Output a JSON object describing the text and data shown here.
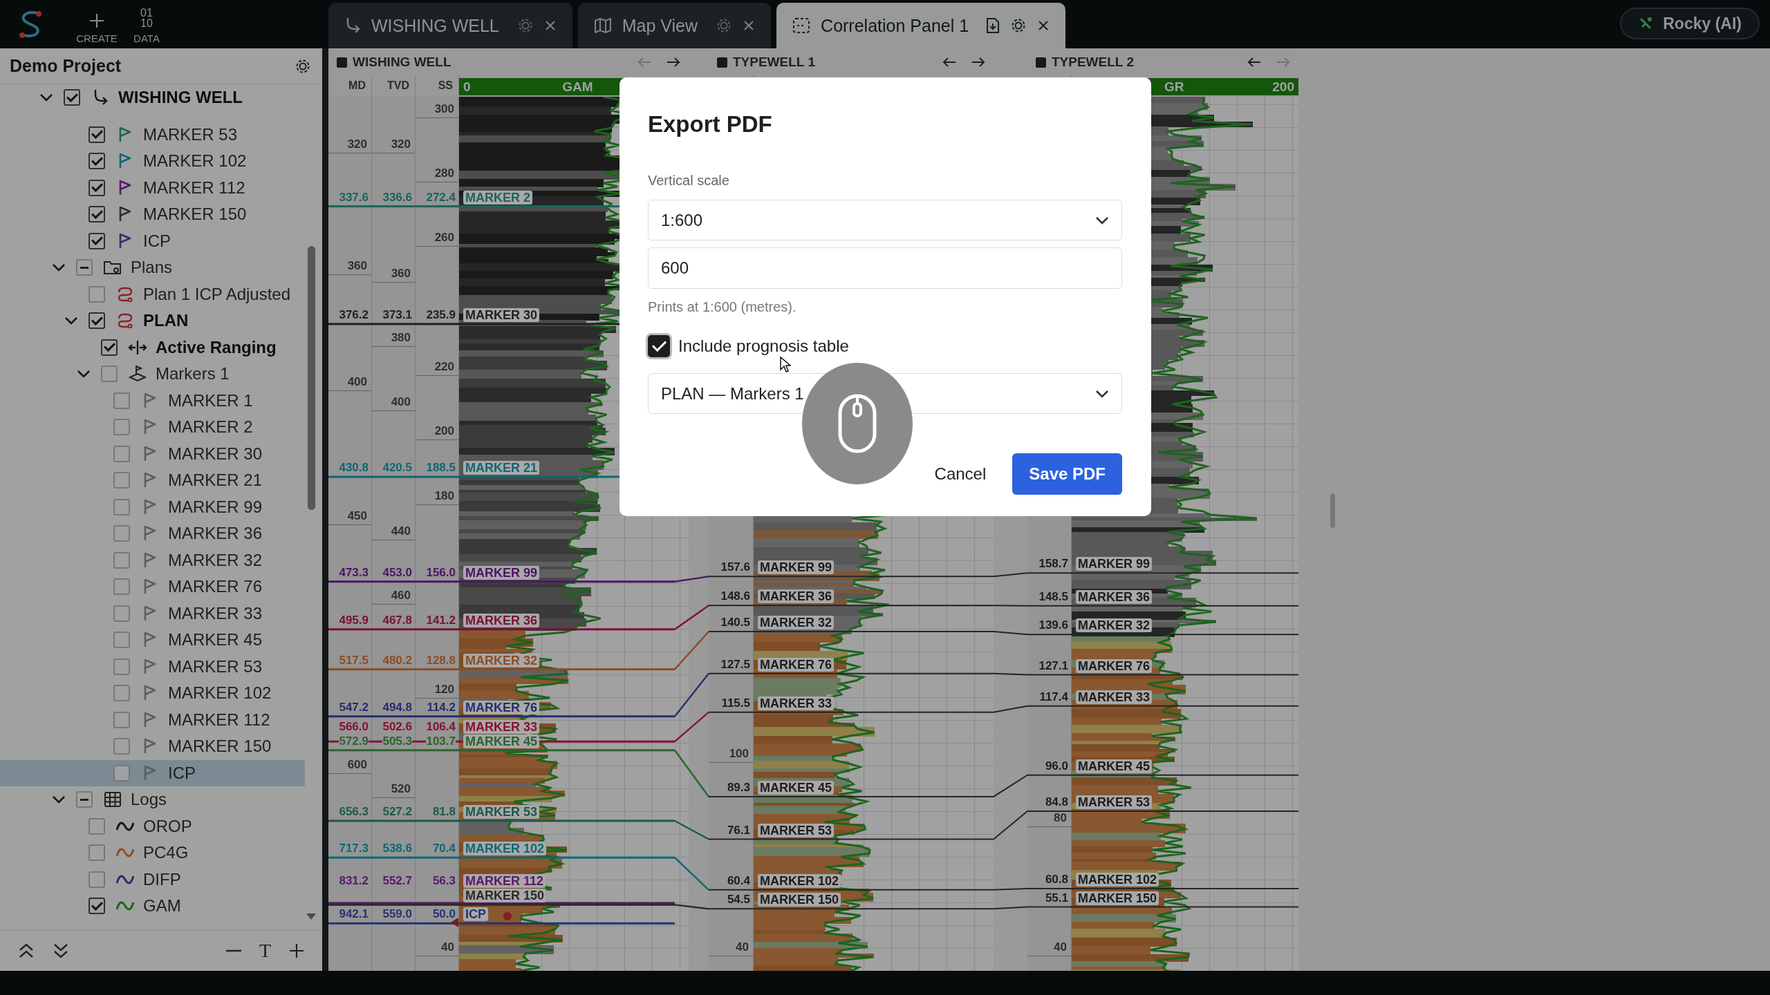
{
  "app_bar": {
    "actions": [
      {
        "kind": "create",
        "label": "CREATE"
      },
      {
        "kind": "data",
        "label": "DATA",
        "glyph": [
          "01",
          "10"
        ]
      }
    ]
  },
  "tabs": [
    {
      "kind": "well",
      "label": "WISHING WELL",
      "selected": false
    },
    {
      "kind": "map",
      "label": "Map View",
      "selected": false
    },
    {
      "kind": "correlation",
      "label": "Correlation Panel 1",
      "selected": true
    }
  ],
  "assistant": {
    "label": "Rocky (AI)"
  },
  "sidebar": {
    "title": "Demo Project",
    "toolbar": {
      "glyph": "T"
    },
    "tree": [
      {
        "kind": "well",
        "label": "WISHING WELL",
        "bold": true,
        "checked": true,
        "expanded": true,
        "selected": false,
        "children": [
          {
            "kind": "marker",
            "label": "MARKER 53",
            "bold": false,
            "checked": true,
            "selected": false,
            "color": "#1d644f"
          },
          {
            "kind": "marker",
            "label": "MARKER 102",
            "bold": false,
            "checked": true,
            "selected": false,
            "color": "#0d6774"
          },
          {
            "kind": "marker",
            "label": "MARKER 112",
            "bold": false,
            "checked": true,
            "selected": false,
            "color": "#59176b"
          },
          {
            "kind": "marker",
            "label": "MARKER 150",
            "bold": false,
            "checked": true,
            "selected": false,
            "color": "#2f2f2f"
          },
          {
            "kind": "marker",
            "label": "ICP",
            "bold": false,
            "checked": true,
            "selected": false,
            "color": "#283372"
          },
          {
            "kind": "folder",
            "label": "Plans",
            "bold": false,
            "checked": false,
            "partial": true,
            "expanded": true,
            "selected": false,
            "children": [
              {
                "kind": "plan",
                "label": "Plan 1 ICP Adjusted",
                "bold": false,
                "checked": false,
                "partial": false,
                "selected": false
              },
              {
                "kind": "plan",
                "label": "PLAN",
                "bold": true,
                "checked": true,
                "expanded": true,
                "selected": false,
                "children": [
                  {
                    "kind": "ranging",
                    "label": "Active Ranging",
                    "bold": true,
                    "checked": true,
                    "selected": false
                  },
                  {
                    "kind": "marker_set",
                    "label": "Markers 1",
                    "bold": false,
                    "checked": false,
                    "partial": false,
                    "expanded": true,
                    "selected": false,
                    "children": [
                      {
                        "kind": "marker",
                        "label": "MARKER 1",
                        "bold": false,
                        "checked": false,
                        "partial": false,
                        "selected": false
                      },
                      {
                        "kind": "marker",
                        "label": "MARKER 2",
                        "bold": false,
                        "checked": false,
                        "partial": false,
                        "selected": false
                      },
                      {
                        "kind": "marker",
                        "label": "MARKER 30",
                        "bold": false,
                        "checked": false,
                        "partial": false,
                        "selected": false
                      },
                      {
                        "kind": "marker",
                        "label": "MARKER 21",
                        "bold": false,
                        "checked": false,
                        "partial": false,
                        "selected": false
                      },
                      {
                        "kind": "marker",
                        "label": "MARKER 99",
                        "bold": false,
                        "checked": false,
                        "partial": false,
                        "selected": false
                      },
                      {
                        "kind": "marker",
                        "label": "MARKER 36",
                        "bold": false,
                        "checked": false,
                        "partial": false,
                        "selected": false
                      },
                      {
                        "kind": "marker",
                        "label": "MARKER 32",
                        "bold": false,
                        "checked": false,
                        "partial": false,
                        "selected": false
                      },
                      {
                        "kind": "marker",
                        "label": "MARKER 76",
                        "bold": false,
                        "checked": false,
                        "partial": false,
                        "selected": false
                      },
                      {
                        "kind": "marker",
                        "label": "MARKER 33",
                        "bold": false,
                        "checked": false,
                        "partial": false,
                        "selected": false
                      },
                      {
                        "kind": "marker",
                        "label": "MARKER 45",
                        "bold": false,
                        "checked": false,
                        "partial": false,
                        "selected": false
                      },
                      {
                        "kind": "marker",
                        "label": "MARKER 53",
                        "bold": false,
                        "checked": false,
                        "partial": false,
                        "selected": false
                      },
                      {
                        "kind": "marker",
                        "label": "MARKER 102",
                        "bold": false,
                        "checked": false,
                        "partial": false,
                        "selected": false
                      },
                      {
                        "kind": "marker",
                        "label": "MARKER 112",
                        "bold": false,
                        "checked": false,
                        "partial": false,
                        "selected": false
                      },
                      {
                        "kind": "marker",
                        "label": "MARKER 150",
                        "bold": false,
                        "checked": false,
                        "partial": false,
                        "selected": false
                      },
                      {
                        "kind": "marker",
                        "label": "ICP",
                        "bold": false,
                        "checked": false,
                        "partial": false,
                        "selected": true
                      }
                    ]
                  }
                ]
              }
            ]
          },
          {
            "kind": "logs",
            "label": "Logs",
            "bold": false,
            "checked": false,
            "partial": true,
            "expanded": true,
            "selected": false,
            "children": [
              {
                "kind": "log",
                "label": "OROP",
                "bold": false,
                "checked": false,
                "partial": false,
                "selected": false,
                "color": "#151515"
              },
              {
                "kind": "log",
                "label": "PC4G",
                "bold": false,
                "checked": false,
                "partial": false,
                "selected": false,
                "color": "#8d4d24"
              },
              {
                "kind": "log",
                "label": "DIFP",
                "bold": false,
                "checked": false,
                "partial": false,
                "selected": false,
                "color": "#242e6c"
              },
              {
                "kind": "log",
                "label": "GAM",
                "bold": false,
                "checked": true,
                "selected": false,
                "color": "#1d641d"
              }
            ]
          }
        ]
      }
    ]
  },
  "panels": [
    {
      "kind": "well",
      "title": "WISHING WELL",
      "back_enabled": false,
      "forward_enabled": true,
      "columns": [
        "MD",
        "TVD",
        "SS"
      ],
      "log": {
        "min": "0",
        "name": "GAM"
      },
      "md_ticks": [
        "320",
        "360",
        "400",
        "450",
        "600"
      ],
      "tvd_ticks": [
        "320",
        "360",
        "380",
        "400",
        "440",
        "460",
        "520"
      ],
      "ss_ticks": [
        "300",
        "280",
        "260",
        "220",
        "200",
        "180",
        "120",
        "40"
      ]
    },
    {
      "kind": "typewell",
      "title": "TYPEWELL 1",
      "back_enabled": true,
      "forward_enabled": true,
      "ticks": [
        "100",
        "40"
      ]
    },
    {
      "kind": "typewell",
      "title": "TYPEWELL 2",
      "back_enabled": true,
      "forward_enabled": false,
      "log": {
        "name": "GR",
        "max": "200"
      },
      "ticks": [
        "80",
        "40"
      ]
    }
  ],
  "correlation": {
    "markers": [
      {
        "color": "#1a635a",
        "well": {
          "name": "MARKER 2",
          "md": "337.6",
          "tvd": "336.6",
          "ss": "272.4"
        }
      },
      {
        "color": "#202020",
        "well": {
          "name": "MARKER 30",
          "md": "376.2",
          "tvd": "373.1",
          "ss": "235.9"
        }
      },
      {
        "color": "#0e6674",
        "well": {
          "name": "MARKER 21",
          "md": "430.8",
          "tvd": "420.5",
          "ss": "188.5"
        }
      },
      {
        "color": "#4d1466",
        "well": {
          "name": "MARKER 99",
          "md": "473.3",
          "tvd": "453.0",
          "ss": "156.0"
        },
        "typewell_1": {
          "name": "MARKER 99",
          "depth": "157.6"
        },
        "typewell_2": {
          "name": "MARKER 99",
          "depth": "158.7"
        }
      },
      {
        "color": "#7a0f39",
        "well": {
          "name": "MARKER 36",
          "md": "495.9",
          "tvd": "467.8",
          "ss": "141.2"
        },
        "typewell_1": {
          "name": "MARKER 36",
          "depth": "148.6"
        },
        "typewell_2": {
          "name": "MARKER 36",
          "depth": "148.5"
        }
      },
      {
        "color": "#8d4d24",
        "well": {
          "name": "MARKER 32",
          "md": "517.5",
          "tvd": "480.2",
          "ss": "128.8"
        },
        "typewell_1": {
          "name": "MARKER 32",
          "depth": "140.5"
        },
        "typewell_2": {
          "name": "MARKER 32",
          "depth": "139.6"
        }
      },
      {
        "color": "#242e6c",
        "well": {
          "name": "MARKER 76",
          "md": "547.2",
          "tvd": "494.8",
          "ss": "114.2"
        },
        "typewell_1": {
          "name": "MARKER 76",
          "depth": "127.5"
        },
        "typewell_2": {
          "name": "MARKER 76",
          "depth": "127.1"
        }
      },
      {
        "color": "#88112f",
        "well": {
          "name": "MARKER 33",
          "md": "566.0",
          "tvd": "502.6",
          "ss": "106.4"
        },
        "typewell_1": {
          "name": "MARKER 33",
          "depth": "115.5"
        },
        "typewell_2": {
          "name": "MARKER 33",
          "depth": "117.4"
        }
      },
      {
        "color": "#2a652d",
        "well": {
          "name": "MARKER 45",
          "md": "572.9",
          "tvd": "505.3",
          "ss": "103.7"
        },
        "typewell_1": {
          "name": "MARKER 45",
          "depth": "89.3"
        },
        "typewell_2": {
          "name": "MARKER 45",
          "depth": "96.0"
        }
      },
      {
        "color": "#1d584d",
        "well": {
          "name": "MARKER 53",
          "md": "656.3",
          "tvd": "527.2",
          "ss": "81.8"
        },
        "typewell_1": {
          "name": "MARKER 53",
          "depth": "76.1"
        },
        "typewell_2": {
          "name": "MARKER 53",
          "depth": "84.8"
        }
      },
      {
        "color": "#0d6774",
        "well": {
          "name": "MARKER 102",
          "md": "717.3",
          "tvd": "538.6",
          "ss": "70.4"
        },
        "typewell_1": {
          "name": "MARKER 102",
          "depth": "60.4"
        },
        "typewell_2": {
          "name": "MARKER 102",
          "depth": "60.8"
        }
      },
      {
        "color": "#59176b",
        "well": {
          "name": "MARKER 112",
          "md": "831.2",
          "tvd": "552.7",
          "ss": "56.3"
        }
      },
      {
        "color": "#2b2b2b",
        "well": {
          "name": "MARKER 150"
        },
        "typewell_1": {
          "name": "MARKER 150",
          "depth": "54.5"
        },
        "typewell_2": {
          "name": "MARKER 150",
          "depth": "55.1"
        }
      },
      {
        "color": "#283372",
        "well": {
          "name": "ICP",
          "md": "942.1",
          "tvd": "559.0",
          "ss": "50.0"
        }
      }
    ]
  },
  "dialog": {
    "title": "Export PDF",
    "scale_label": "Vertical scale",
    "scale_select": "1:600",
    "scale_input": "600",
    "hint": "Prints at 1:600 (metres).",
    "include_table": {
      "label": "Include prognosis table",
      "checked": true
    },
    "table_select": "PLAN — Markers 1",
    "buttons": [
      {
        "kind": "secondary",
        "label": "Cancel"
      },
      {
        "kind": "primary",
        "label": "Save PDF"
      }
    ]
  }
}
